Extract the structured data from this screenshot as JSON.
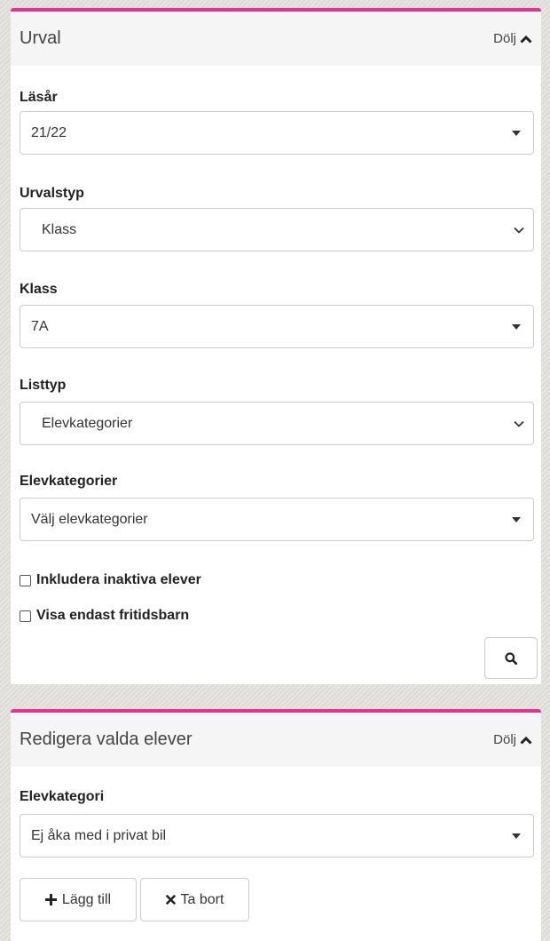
{
  "urval": {
    "title": "Urval",
    "hide_label": "Dölj",
    "fields": {
      "lasar": {
        "label": "Läsår",
        "value": "21/22"
      },
      "urvalstyp": {
        "label": "Urvalstyp",
        "value": "Klass"
      },
      "klass": {
        "label": "Klass",
        "value": "7A"
      },
      "listtyp": {
        "label": "Listtyp",
        "value": "Elevkategorier"
      },
      "elevkategorier": {
        "label": "Elevkategorier",
        "value": "Välj elevkategorier"
      }
    },
    "checkboxes": {
      "include_inactive": {
        "label": "Inkludera inaktiva elever",
        "checked": false
      },
      "only_leisure": {
        "label": "Visa endast fritidsbarn",
        "checked": false
      }
    },
    "search_icon": "search-icon"
  },
  "edit": {
    "title": "Redigera valda elever",
    "hide_label": "Dölj",
    "elevkategori": {
      "label": "Elevkategori",
      "value": "Ej åka med i privat bil"
    },
    "add_label": "Lägg till",
    "remove_label": "Ta bort"
  },
  "colors": {
    "accent": "#e2338e",
    "header_bg": "#f5f5f5"
  }
}
